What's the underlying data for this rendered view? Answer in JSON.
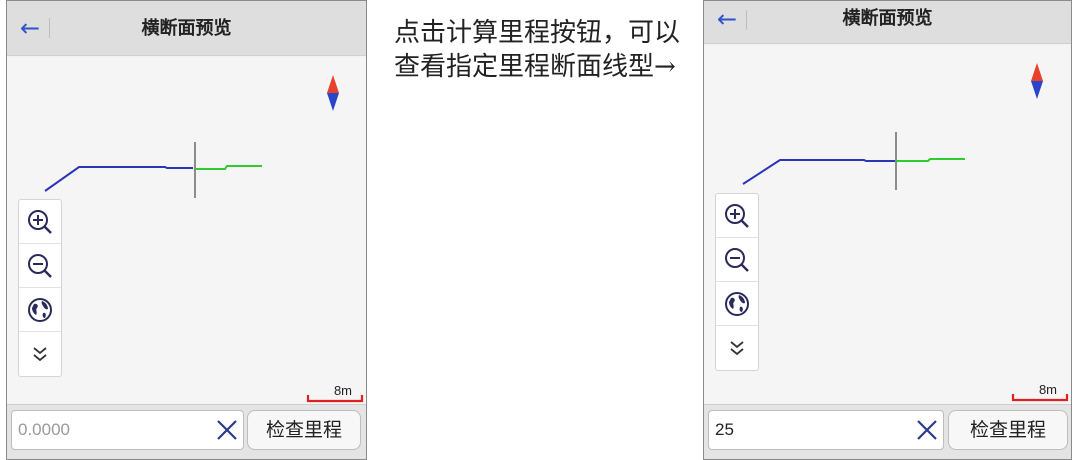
{
  "caption": "点击计算里程按钮，可以查看指定里程断面线型→",
  "screens": [
    {
      "title": "横断面预览",
      "scale_label": "8m",
      "mileage_value": "",
      "mileage_placeholder": "0.0000",
      "check_button_label": "检查里程"
    },
    {
      "title": "横断面预览",
      "scale_label": "8m",
      "mileage_value": "25",
      "mileage_placeholder": "0.0000",
      "check_button_label": "检查里程"
    }
  ],
  "icons": {
    "back": "arrow-left-icon",
    "compass": "compass-icon",
    "zoom_in": "zoom-in-icon",
    "zoom_out": "zoom-out-icon",
    "full_extent": "globe-icon",
    "expand": "double-chevron-down-icon",
    "clear": "close-icon"
  },
  "colors": {
    "accent": "#2f53c8",
    "line_blue": "#2b35b5",
    "line_green": "#2ecc2e",
    "scale_red": "#e02020",
    "compass_red": "#e8402a",
    "compass_blue": "#2b45c9"
  }
}
